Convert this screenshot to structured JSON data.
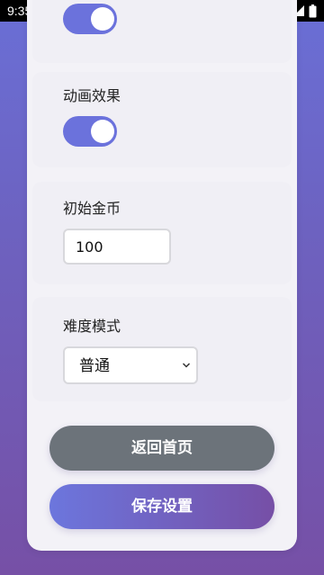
{
  "status_bar": {
    "time": "9:35",
    "notification_icon": "A"
  },
  "settings": {
    "animation": {
      "label": "动画效果",
      "enabled": true
    },
    "initial_coins": {
      "label": "初始金币",
      "value": "100"
    },
    "difficulty": {
      "label": "难度模式",
      "selected": "普通"
    },
    "previous_toggle_enabled": true
  },
  "buttons": {
    "back_label": "返回首页",
    "save_label": "保存设置"
  },
  "colors": {
    "accent": "#6b72dc",
    "back_button": "#6c737a",
    "save_gradient_start": "#6c76dd",
    "save_gradient_end": "#764fa6"
  }
}
